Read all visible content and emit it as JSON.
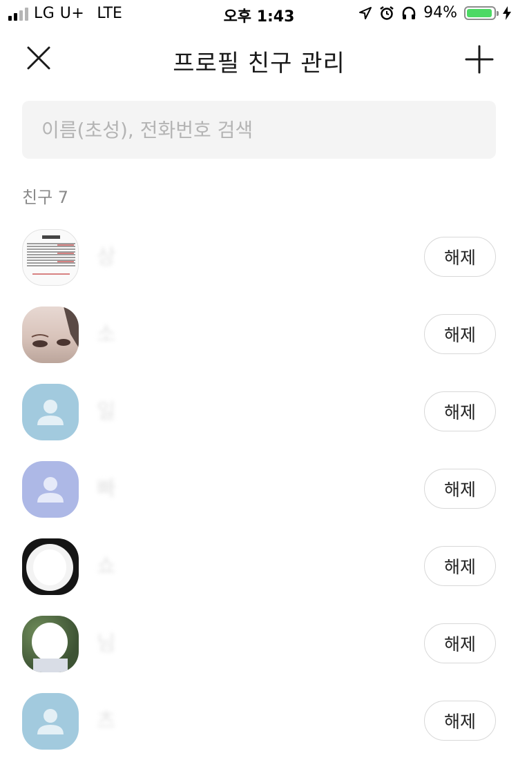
{
  "status_bar": {
    "carrier": "LG U+",
    "network": "LTE",
    "time": "오후 1:43",
    "battery_percent": "94%",
    "battery_level": 0.94,
    "icons": [
      "location-arrow-icon",
      "alarm-clock-icon",
      "headphones-icon",
      "battery-icon",
      "charging-bolt-icon"
    ]
  },
  "header": {
    "title": "프로필 친구 관리",
    "close_icon": "close-icon",
    "add_icon": "plus-icon"
  },
  "search": {
    "placeholder": "이름(초성), 전화번호 검색",
    "value": ""
  },
  "friends": {
    "count_label": "친구 7",
    "release_label": "해제",
    "items": [
      {
        "name": "상",
        "avatar": "document-image"
      },
      {
        "name": "소",
        "avatar": "face-photo"
      },
      {
        "name": "일",
        "avatar": "default-person",
        "color": "#a2cade"
      },
      {
        "name": "빠",
        "avatar": "default-person",
        "color": "#adb8e6"
      },
      {
        "name": "쇼",
        "avatar": "photo-dark"
      },
      {
        "name": "님",
        "avatar": "photo-outdoor"
      },
      {
        "name": "츠",
        "avatar": "default-person",
        "color": "#a2cade"
      }
    ]
  }
}
